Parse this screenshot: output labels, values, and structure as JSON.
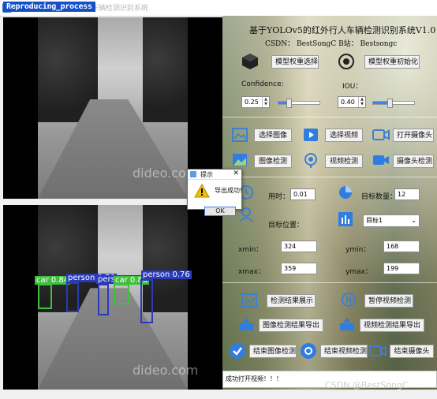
{
  "window": {
    "title": "基于YOLOv5的红外行人车辆检测识别系统",
    "recording_badge": "Reproducing_process"
  },
  "video": {
    "watermark": "dideo.com",
    "detections": [
      {
        "label": "car 0.84",
        "color": "#40c040"
      },
      {
        "label": "person 0.76",
        "color": "#2a3ab8"
      },
      {
        "label": "person 0.76",
        "color": "#2a3ab8"
      },
      {
        "label": "car 0.86",
        "color": "#40c040"
      },
      {
        "label": "person 0.76",
        "color": "#2a3ab8"
      }
    ]
  },
  "panel": {
    "title": "基于YOLOv5的红外行人车辆检测识别系统V1.0",
    "subtitle": "CSDN：  BestSongC   B站：  Bestsongc",
    "model_select": "模型权重选择",
    "model_init": "模型权重初始化",
    "confidence_label": "Confidence:",
    "iou_label": "IOU：",
    "confidence_value": "0.25",
    "iou_value": "0.40",
    "confidence_slider": 0.25,
    "iou_slider": 0.4,
    "select_image": "选择图像",
    "select_video": "选择视频",
    "open_camera": "打开摄像头",
    "image_detect": "图像检测",
    "video_detect": "视频检测",
    "camera_detect": "摄像头检测",
    "time_label": "用时：",
    "time_value": "0.01",
    "target_count_label": "目标数量：",
    "target_count_value": "12",
    "target_pos_label": "目标位置：",
    "target_select": "目标1",
    "xmin_label": "xmin：",
    "xmin_value": "324",
    "ymin_label": "ymin：",
    "ymin_value": "168",
    "xmax_label": "xmax：",
    "xmax_value": "359",
    "ymax_label": "ymax：",
    "ymax_value": "199",
    "show_results": "检测结果展示",
    "pause_video": "暂停视频检测",
    "export_image_results": "图像检测结果导出",
    "export_video_results": "视频检测结果导出",
    "end_image_detect": "结束图像检测",
    "end_video_detect": "结束视频检测",
    "end_camera": "结束摄像头",
    "status": "成功打开视频！！！",
    "csdn_watermark": "CSDN @BestSongC"
  },
  "dialog": {
    "title": "提示",
    "message": "导出成功!",
    "ok": "OK"
  },
  "colors": {
    "accent": "#3b82f6",
    "icon": "#3f7fd0"
  }
}
